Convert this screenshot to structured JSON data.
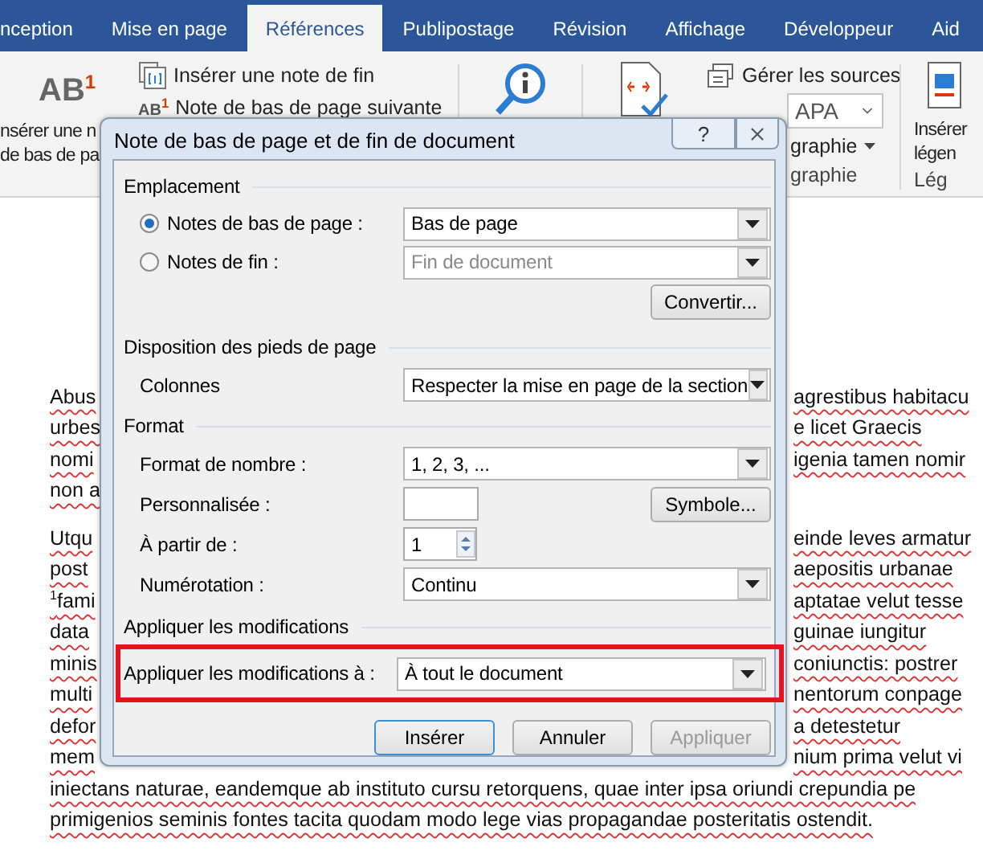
{
  "ribbon": {
    "tabs": [
      {
        "label": "nception",
        "selected": false
      },
      {
        "label": "Mise en page",
        "selected": false
      },
      {
        "label": "Références",
        "selected": true
      },
      {
        "label": "Publipostage",
        "selected": false
      },
      {
        "label": "Révision",
        "selected": false
      },
      {
        "label": "Affichage",
        "selected": false
      },
      {
        "label": "Développeur",
        "selected": false
      },
      {
        "label": "Aid",
        "selected": false
      }
    ],
    "footnote_icon": "AB$^{1}$",
    "footnote_lines": [
      "nsérer une n",
      "de bas de pa"
    ],
    "insert_endnote": "Insérer une note de fin",
    "next_footnote_icon": "AB$^{1}$",
    "next_footnote": "Note de bas de page suivante",
    "manage_sources": "Gérer les sources",
    "style_value": "APA",
    "bibliography_button": "graphie",
    "group_label": "graphie",
    "caption_lines": [
      "Insérer",
      "légen"
    ],
    "caption_group_label": "Lég"
  },
  "document": {
    "paragraphs": [
      [
        {
          "left": "Abus",
          "right": "agrestibus habitacu"
        },
        {
          "left": "urbes",
          "right": "e licet Graecis"
        },
        {
          "left": "nomi",
          "right": "igenia tamen nomir"
        },
        {
          "left": "non a"
        }
      ],
      [
        {
          "left": "Utqu",
          "right": "einde leves armatur"
        },
        {
          "left": "post",
          "right": "aepositis urbanae"
        },
        {
          "left": "$^{1}$fami",
          "right": "aptatae velut tesse"
        },
        {
          "left": "data",
          "right": "guinae iungitur"
        },
        {
          "left": "minis",
          "right": "coniunctis: postrer"
        },
        {
          "left": "multi",
          "right": "nentorum conpage"
        },
        {
          "left": "defor",
          "right": "a detestetur"
        },
        {
          "left": "mem",
          "right": "nium prima velut vi"
        },
        {
          "full": "iniectans naturae, eandemque ab instituto cursu retorquens, quae inter ipsa oriundi crepundia pe"
        },
        {
          "full": "primigenios seminis fontes tacita quodam modo lege vias propagandae posteritatis ostendit."
        }
      ]
    ]
  },
  "dialog": {
    "title": "Note de bas de page et de fin de document",
    "help_button": "?",
    "sections": [
      {
        "heading": "Emplacement",
        "rows": [
          {
            "kind": "radio",
            "label": "Notes de bas de page :",
            "selected": true,
            "value": "Bas de page",
            "disabled": false
          },
          {
            "kind": "radio",
            "label": "Notes de fin :",
            "selected": false,
            "value": "Fin de document",
            "disabled": true
          },
          {
            "kind": "button",
            "label": "Convertir..."
          }
        ]
      },
      {
        "heading": "Disposition des pieds de page",
        "rows": [
          {
            "kind": "dropdown",
            "label": "Colonnes",
            "value": "Respecter la mise en page de la section",
            "highlighted": false
          }
        ]
      },
      {
        "heading": "Format",
        "rows": [
          {
            "kind": "dropdown",
            "label": "Format de nombre :",
            "value": "1, 2, 3, ...",
            "highlighted": false
          },
          {
            "kind": "input",
            "label": "Personnalisée :",
            "button": "Symbole..."
          },
          {
            "kind": "spin",
            "label": "À partir de :",
            "value": "1"
          },
          {
            "kind": "dropdown",
            "label": "Numérotation :",
            "value": "Continu",
            "highlighted": false
          }
        ]
      },
      {
        "heading": "Appliquer les modifications",
        "rows": [
          {
            "kind": "dropdown",
            "label": "Appliquer les modifications à :",
            "value": "À tout le document",
            "highlighted": true
          }
        ]
      }
    ],
    "buttons": [
      {
        "label": "Insérer",
        "default": true,
        "disabled": false
      },
      {
        "label": "Annuler",
        "default": false,
        "disabled": false
      },
      {
        "label": "Appliquer",
        "default": false,
        "disabled": true
      }
    ]
  }
}
